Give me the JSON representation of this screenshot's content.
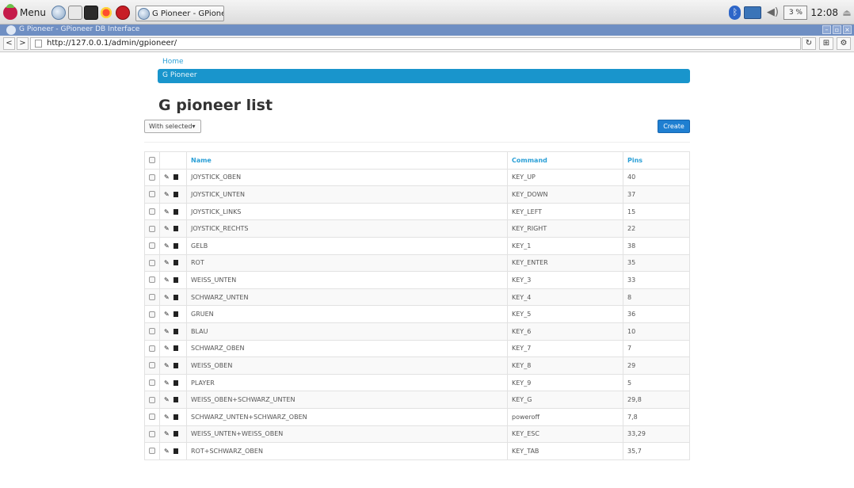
{
  "taskbar": {
    "menu_label": "Menu",
    "task_label": "G Pioneer - GPioneer ...",
    "cpu": "3 %",
    "clock": "12:08"
  },
  "window": {
    "title": "G Pioneer - GPioneer DB Interface"
  },
  "browser": {
    "url": "http://127.0.0.1/admin/gpioneer/"
  },
  "page": {
    "breadcrumb_home": "Home",
    "navbar_label": "G Pioneer",
    "heading": "G pioneer list",
    "with_selected": "With selected▾",
    "create": "Create"
  },
  "table": {
    "headers": [
      "Name",
      "Command",
      "Pins"
    ],
    "rows": [
      {
        "name": "JOYSTICK_OBEN",
        "command": "KEY_UP",
        "pins": "40"
      },
      {
        "name": "JOYSTICK_UNTEN",
        "command": "KEY_DOWN",
        "pins": "37"
      },
      {
        "name": "JOYSTICK_LINKS",
        "command": "KEY_LEFT",
        "pins": "15"
      },
      {
        "name": "JOYSTICK_RECHTS",
        "command": "KEY_RIGHT",
        "pins": "22"
      },
      {
        "name": "GELB",
        "command": "KEY_1",
        "pins": "38"
      },
      {
        "name": "ROT",
        "command": "KEY_ENTER",
        "pins": "35"
      },
      {
        "name": "WEISS_UNTEN",
        "command": "KEY_3",
        "pins": "33"
      },
      {
        "name": "SCHWARZ_UNTEN",
        "command": "KEY_4",
        "pins": "8"
      },
      {
        "name": "GRUEN",
        "command": "KEY_5",
        "pins": "36"
      },
      {
        "name": "BLAU",
        "command": "KEY_6",
        "pins": "10"
      },
      {
        "name": "SCHWARZ_OBEN",
        "command": "KEY_7",
        "pins": "7"
      },
      {
        "name": "WEISS_OBEN",
        "command": "KEY_8",
        "pins": "29"
      },
      {
        "name": "PLAYER",
        "command": "KEY_9",
        "pins": "5"
      },
      {
        "name": "WEISS_OBEN+SCHWARZ_UNTEN",
        "command": "KEY_G",
        "pins": "29,8"
      },
      {
        "name": "SCHWARZ_UNTEN+SCHWARZ_OBEN",
        "command": "poweroff",
        "pins": "7,8"
      },
      {
        "name": "WEISS_UNTEN+WEISS_OBEN",
        "command": "KEY_ESC",
        "pins": "33,29"
      },
      {
        "name": "ROT+SCHWARZ_OBEN",
        "command": "KEY_TAB",
        "pins": "35,7"
      }
    ]
  }
}
